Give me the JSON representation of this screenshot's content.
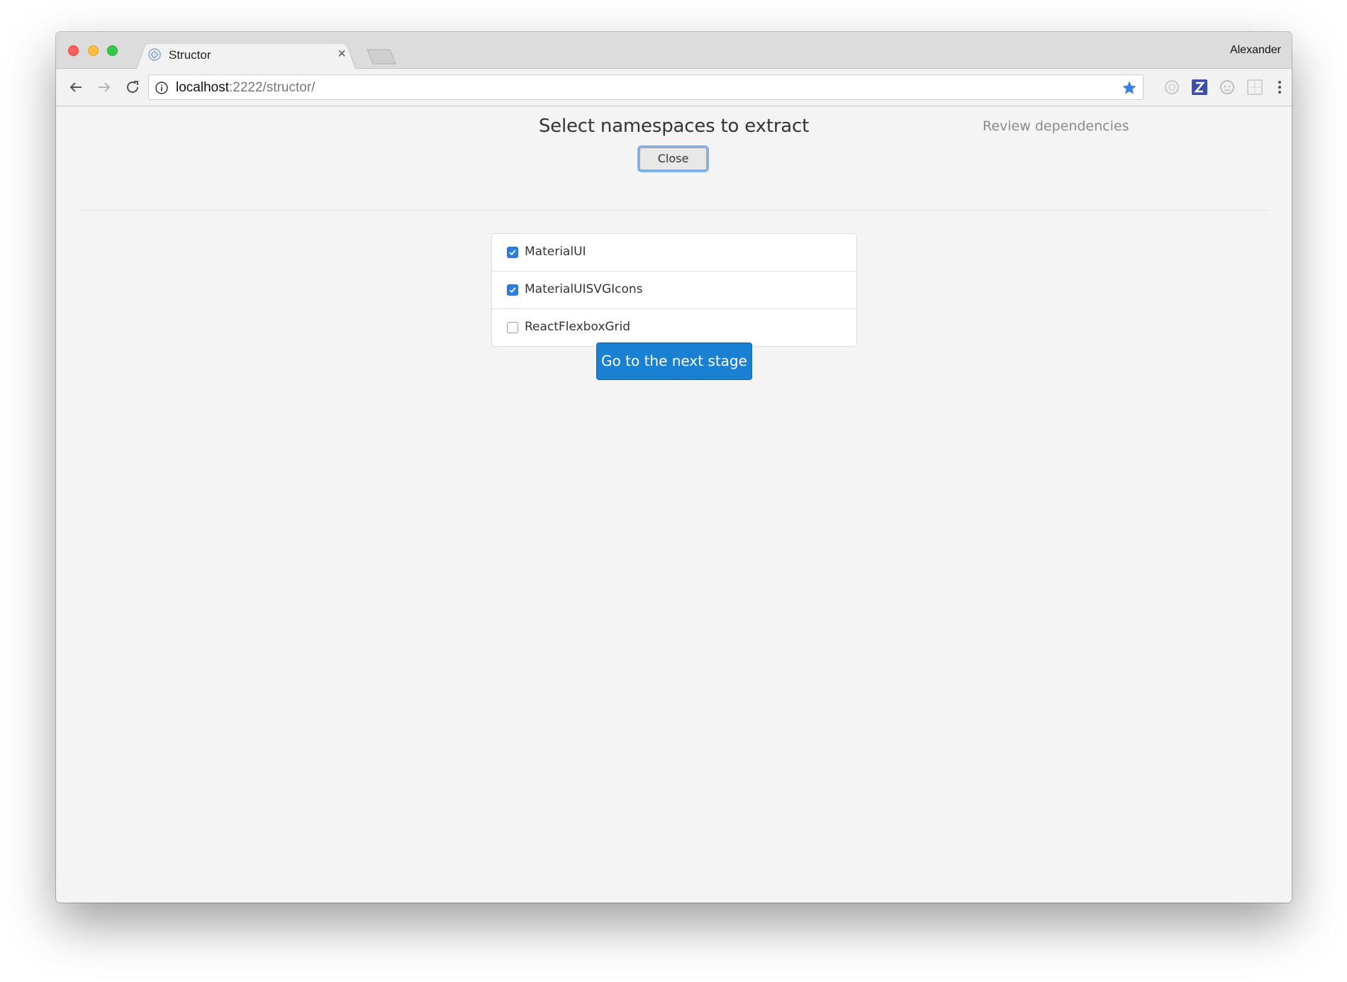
{
  "browser": {
    "tab_title": "Structor",
    "tab_close": "×",
    "profile_name": "Alexander",
    "url_host": "localhost",
    "url_rest": ":2222/structor/"
  },
  "toolbar_icons": [
    "back-arrow-icon",
    "forward-arrow-icon",
    "reload-icon",
    "info-icon",
    "bookmark-star-icon",
    "extension-icons",
    "menu-dots-icon"
  ],
  "page": {
    "title": "Select namespaces to extract",
    "close_label": "Close",
    "review_label": "Review dependencies",
    "namespaces": [
      {
        "label": "MaterialUI",
        "checked": true
      },
      {
        "label": "MaterialUISVGIcons",
        "checked": true
      },
      {
        "label": "ReactFlexboxGrid",
        "checked": false
      }
    ],
    "next_label": "Go to the next stage"
  },
  "colors": {
    "accent": "#1a80d2",
    "checkbox": "#2d7fde",
    "bookmark_star": "#3b7fe5"
  }
}
